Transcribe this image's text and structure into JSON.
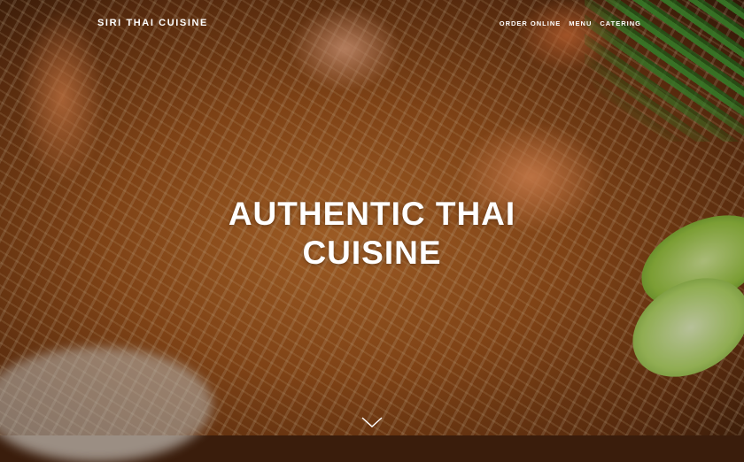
{
  "header": {
    "brand": "SIRI THAI CUISINE",
    "nav": [
      {
        "label": "ORDER ONLINE"
      },
      {
        "label": "MENU"
      },
      {
        "label": "CATERING"
      }
    ]
  },
  "hero": {
    "headline_line1": "AUTHENTIC THAI",
    "headline_line2": "CUISINE",
    "scroll_icon": "chevron-down-icon",
    "background_image": "pad thai with shrimp, bean sprouts, lime and scallions"
  },
  "colors": {
    "text": "#ffffff",
    "overlay": "rgba(0,0,0,0.22)"
  }
}
